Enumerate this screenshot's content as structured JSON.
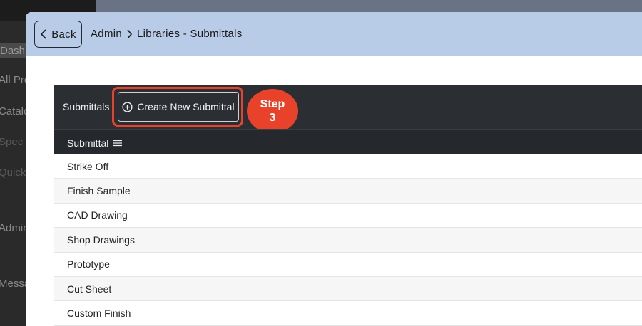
{
  "background": {
    "nav_items": [
      "Dashb",
      "All Pro",
      "Catalo",
      "Spec S",
      "Quick",
      "Admin",
      "Messa"
    ]
  },
  "header": {
    "back_label": "Back",
    "breadcrumb": [
      "Admin",
      "Libraries - Submittals"
    ]
  },
  "toolbar": {
    "title": "Submittals",
    "create_label": "Create New Submittal"
  },
  "annotation": {
    "step_line1": "Step",
    "step_line2": "3",
    "color": "#e8432a"
  },
  "table": {
    "column": "Submittal",
    "rows": [
      "Strike Off",
      "Finish Sample",
      "CAD Drawing",
      "Shop Drawings",
      "Prototype",
      "Cut Sheet",
      "Custom Finish"
    ]
  },
  "colors": {
    "header_bg": "#b8cce8",
    "toolbar_bg": "#2b2f33"
  }
}
